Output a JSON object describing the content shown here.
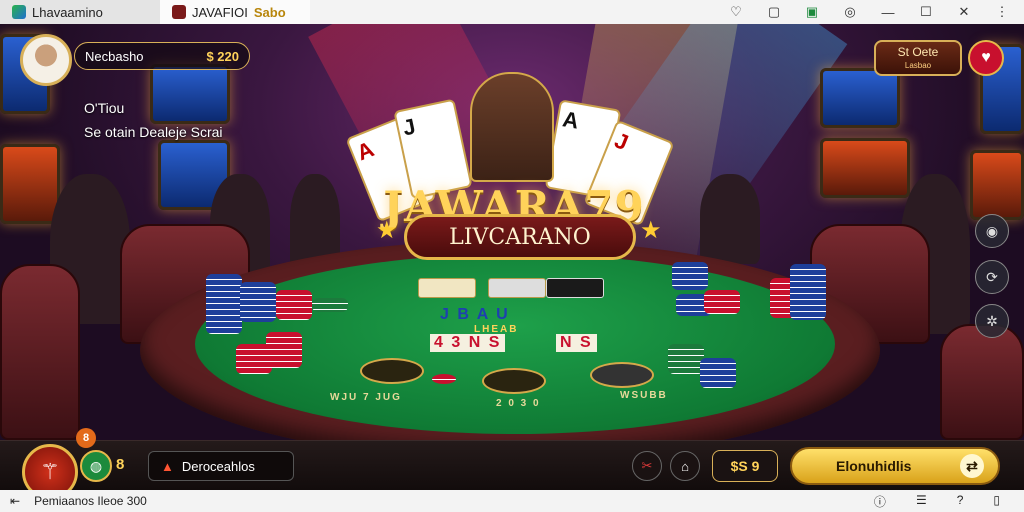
{
  "window": {
    "tab1_title": "Lhavaamino",
    "tab2_title": "JAVAFIOI",
    "tab2_badge": "Sabo",
    "controls": [
      "♡",
      "▢",
      "▣",
      "◎",
      "—",
      "☐",
      "✕",
      "⋮"
    ]
  },
  "player": {
    "name": "Necbasho",
    "balance": "$ 220",
    "line1": "O'Tiou",
    "line2": "Se otain Dealeje Scrai"
  },
  "logo": {
    "title": "JAWARA79",
    "banner": "LIVCARANO"
  },
  "felt": {
    "row1": "J B A U",
    "row1_sub": "LHEAB",
    "row2": "4 3 N S",
    "row2_right": "N S",
    "bottom_left": "WJU 7 JUG",
    "bottom_mid": "2 0 3 0",
    "bottom_right": "WSUBB"
  },
  "top_right": {
    "button_label": "St Oete",
    "button_sub": "Lasbao",
    "red_icon": "heart-icon"
  },
  "side_icons": [
    "camera-icon",
    "refresh-icon",
    "settings-icon"
  ],
  "bottom": {
    "notif_count": "8",
    "count": "8",
    "menu_label": "Deroceahlos",
    "bet_value": "$S 9",
    "action_label": "Elonuhidlis"
  },
  "status": {
    "left": "Pemiaanos  Ileoe 300",
    "right_icons": [
      "info-icon",
      "list-icon",
      "help-icon",
      "panel-icon"
    ]
  },
  "colors": {
    "gold": "#d8b058",
    "felt_green": "#1ea04a",
    "accent_red": "#c8102e"
  }
}
